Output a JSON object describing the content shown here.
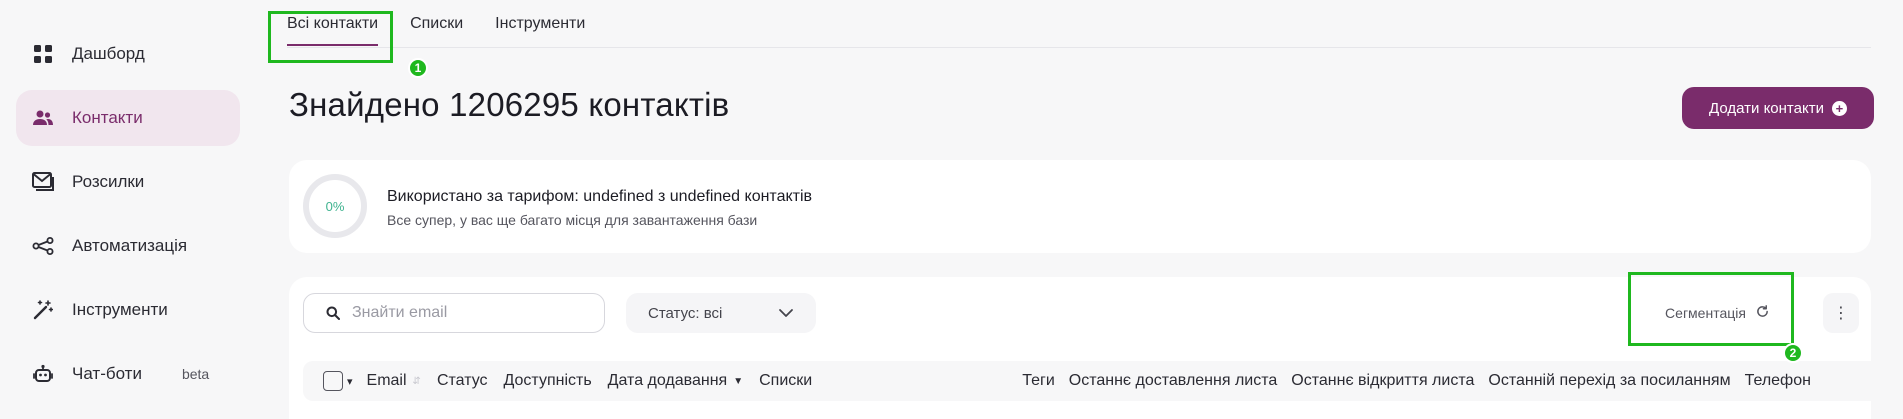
{
  "sidebar": {
    "items": [
      {
        "label": "Дашборд",
        "icon": "grid-icon",
        "active": false
      },
      {
        "label": "Контакти",
        "icon": "users-icon",
        "active": true
      },
      {
        "label": "Розсилки",
        "icon": "mail-icon",
        "active": false
      },
      {
        "label": "Автоматизація",
        "icon": "share-nodes-icon",
        "active": false
      },
      {
        "label": "Інструменти",
        "icon": "magic-wand-icon",
        "active": false
      },
      {
        "label": "Чат-боти",
        "icon": "robot-icon",
        "active": false,
        "badge": "beta"
      }
    ]
  },
  "tabs": [
    {
      "label": "Всі контакти",
      "active": true
    },
    {
      "label": "Списки",
      "active": false
    },
    {
      "label": "Інструменти",
      "active": false
    }
  ],
  "page": {
    "title": "Знайдено 1206295 контактів",
    "add_button": "Додати контакти"
  },
  "usage": {
    "percent_label": "0%",
    "percent": 0,
    "title": "Використано за тарифом: undefined з undefined контактів",
    "subtitle": "Все супер, у вас ще багато місця для завантаження бази"
  },
  "toolbar": {
    "search_placeholder": "Знайти email",
    "status_label": "Статус: всі",
    "segmentation_label": "Сегментація",
    "more_label": "⋮"
  },
  "table": {
    "columns": [
      "Email",
      "Статус",
      "Доступність",
      "Дата додавання",
      "Списки",
      "Теги",
      "Останнє доставлення листа",
      "Останнє відкриття листа",
      "Останній перехід за посиланням",
      "Телефон"
    ]
  },
  "highlights": [
    {
      "number": "1"
    },
    {
      "number": "2"
    }
  ],
  "colors": {
    "brand": "#7a2c6b",
    "active_nav_bg": "#f1e6ee",
    "highlight": "#1fb81f"
  }
}
